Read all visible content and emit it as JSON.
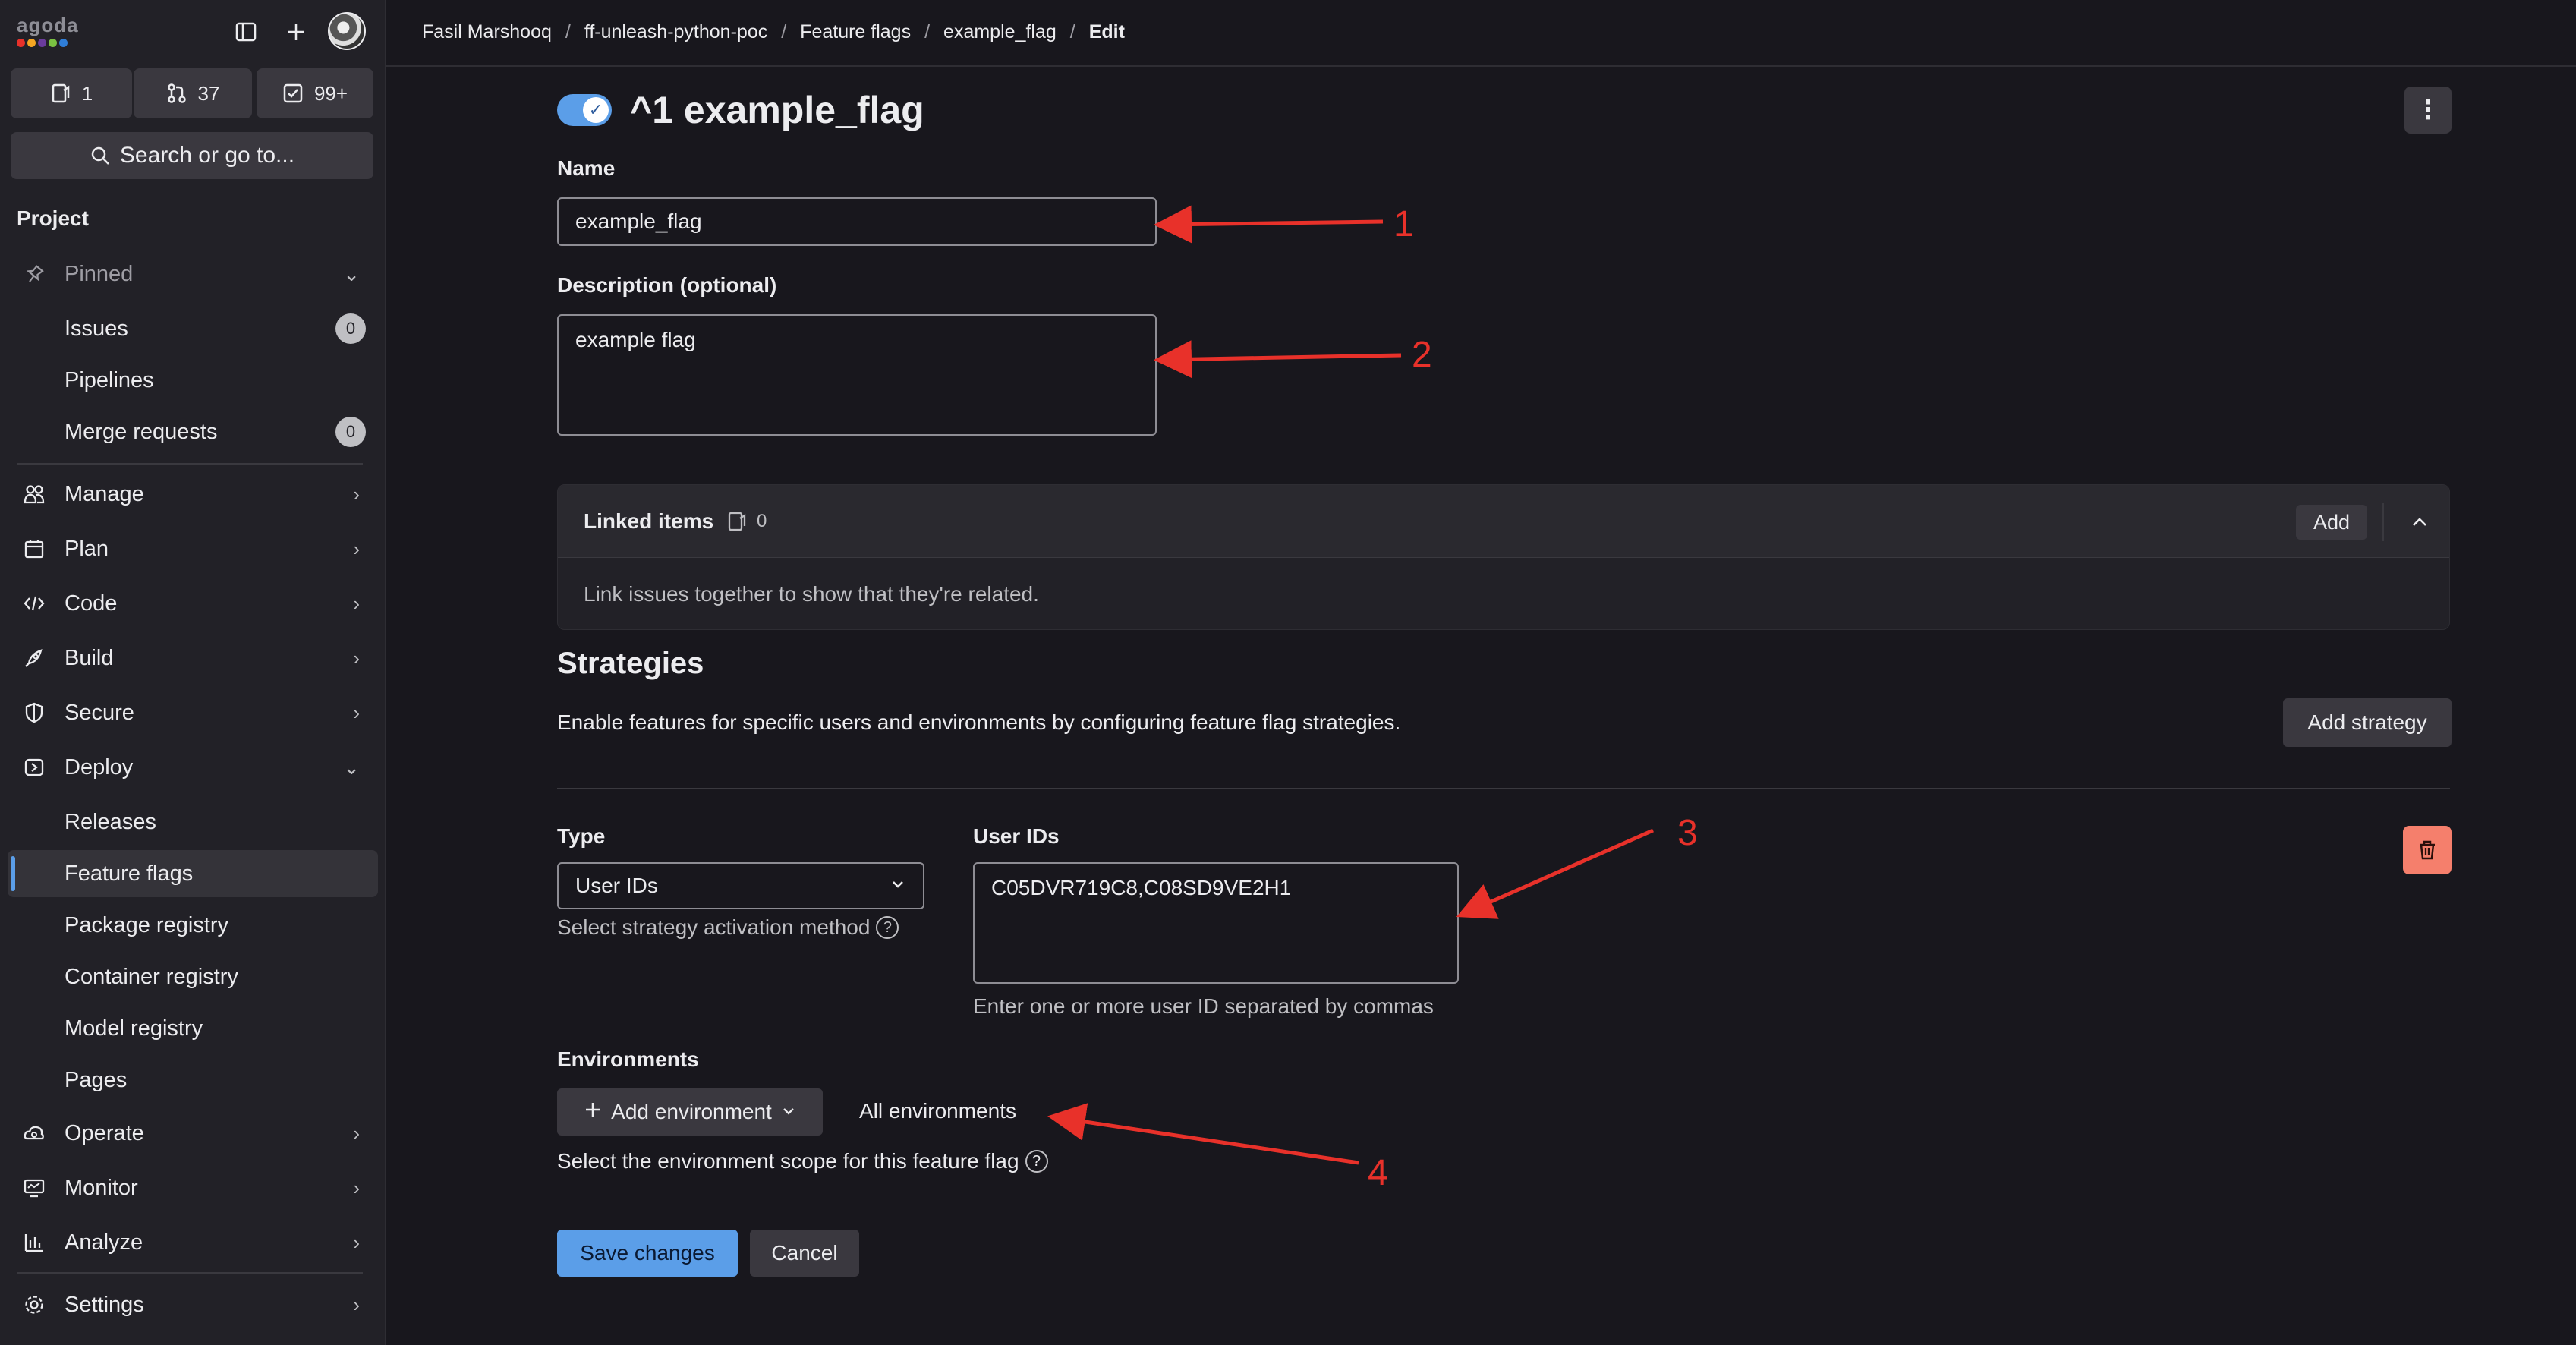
{
  "logo": {
    "text": "agoda",
    "dot_colors": [
      "#e8312a",
      "#f5a623",
      "#6a3c9c",
      "#7ac142",
      "#2f7ed8"
    ]
  },
  "counters": [
    {
      "icon": "issues-icon",
      "value": "1"
    },
    {
      "icon": "merge-request-icon",
      "value": "37"
    },
    {
      "icon": "todo-icon",
      "value": "99+"
    }
  ],
  "search": {
    "label": "Search or go to..."
  },
  "sidebar": {
    "heading": "Project",
    "pinned": "Pinned",
    "items": {
      "issues": "Issues",
      "issues_count": "0",
      "pipelines": "Pipelines",
      "merge_requests": "Merge requests",
      "merge_requests_count": "0",
      "manage": "Manage",
      "plan": "Plan",
      "code": "Code",
      "build": "Build",
      "secure": "Secure",
      "deploy": "Deploy",
      "releases": "Releases",
      "feature_flags": "Feature flags",
      "package_registry": "Package registry",
      "container_registry": "Container registry",
      "model_registry": "Model registry",
      "pages": "Pages",
      "operate": "Operate",
      "monitor": "Monitor",
      "analyze": "Analyze",
      "settings": "Settings"
    }
  },
  "breadcrumb": [
    "Fasil Marshooq",
    "ff-unleash-python-poc",
    "Feature flags",
    "example_flag",
    "Edit"
  ],
  "flag": {
    "title": "^1 example_flag",
    "active": true
  },
  "form": {
    "name_label": "Name",
    "name_value": "example_flag",
    "description_label": "Description (optional)",
    "description_value": "example flag"
  },
  "linked_items": {
    "title": "Linked items",
    "count": "0",
    "add_label": "Add",
    "body": "Link issues together to show that they're related."
  },
  "strategies": {
    "title": "Strategies",
    "description": "Enable features for specific users and environments by configuring feature flag strategies.",
    "add_label": "Add strategy",
    "type_label": "Type",
    "type_value": "User IDs",
    "type_help": "Select strategy activation method",
    "user_ids_label": "User IDs",
    "user_ids_value": "C05DVR719C8,C08SD9VE2H1",
    "user_ids_help": "Enter one or more user ID separated by commas",
    "environments_label": "Environments",
    "add_environment_label": "Add environment",
    "all_environments": "All environments",
    "environments_help": "Select the environment scope for this feature flag"
  },
  "actions": {
    "save": "Save changes",
    "cancel": "Cancel"
  },
  "annotations": [
    "1",
    "2",
    "3",
    "4"
  ],
  "colors": {
    "accent": "#5b9ee8",
    "danger": "#f57f6c",
    "annotation": "#e8312a"
  }
}
